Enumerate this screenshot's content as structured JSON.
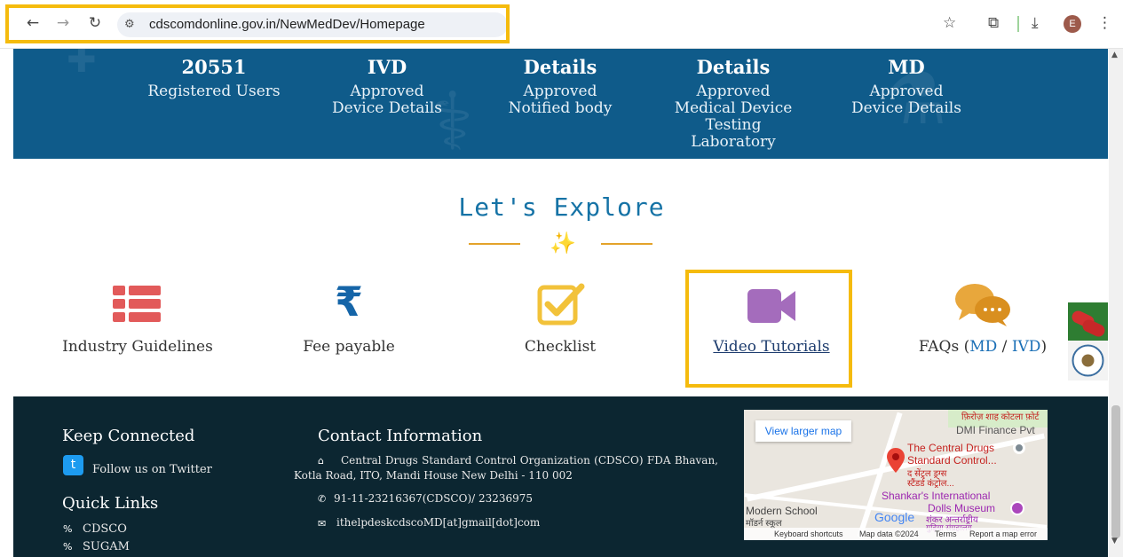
{
  "browser": {
    "url": "cdscomdonline.gov.in/NewMedDev/Homepage",
    "profile_initial": "E"
  },
  "stats": [
    {
      "big": "20551",
      "small": "Registered Users"
    },
    {
      "big": "IVD",
      "small": "Approved Device Details"
    },
    {
      "big": "Details",
      "small": "Approved Notified body"
    },
    {
      "big": "Details",
      "small": "Approved Medical Device Testing Laboratory"
    },
    {
      "big": "MD",
      "small": "Approved Device Details"
    }
  ],
  "explore": {
    "title": "Let's Explore",
    "tiles": [
      {
        "label": "Industry Guidelines",
        "icon": "list-icon"
      },
      {
        "label": "Fee payable",
        "icon": "rupee-icon"
      },
      {
        "label": "Checklist",
        "icon": "checkbox-icon"
      },
      {
        "label": "Video Tutorials",
        "icon": "video-camera-icon"
      },
      {
        "label_prefix": "FAQs (",
        "md": "MD",
        "slash": " / ",
        "ivd": "IVD",
        "label_suffix": ")",
        "icon": "chat-bubbles-icon"
      }
    ]
  },
  "footer": {
    "keep_connected": "Keep Connected",
    "twitter": "Follow us on Twitter",
    "quick_links": "Quick Links",
    "links": [
      "CDSCO",
      "SUGAM"
    ],
    "contact_title": "Contact Information",
    "address": "Central Drugs Standard Control Organization (CDSCO) FDA Bhavan, Kotla Road, ITO, Mandi House New Delhi - 110 002",
    "phone": "91-11-23216367(CDSCO)/ 23236975",
    "email": "ithelpdeskcdscoMD[at]gmail[dot]com"
  },
  "map": {
    "view_larger": "View larger map",
    "place1": "The Central Drugs",
    "place1b": "Standard Control...",
    "place1c": "द सेंट्रल ड्रग्स",
    "place1d": "स्टैंडर्ड कंट्रोल...",
    "place2": "Shankar's International",
    "place2b": "Dolls Museum",
    "place2c": "शंकर अन्तर्राष्ट्रीय",
    "place2d": "गुड़िया संग्रहालय",
    "school": "Modern School",
    "school_hi": "मॉडर्न स्कूल",
    "dmi": "DMI Finance Pvt",
    "fort": "फ़िरोज़ शाह कोटला फ़ोर्ट",
    "google": "Google",
    "kbd": "Keyboard shortcuts",
    "mapdata": "Map data ©2024",
    "terms": "Terms",
    "report": "Report a map error"
  }
}
